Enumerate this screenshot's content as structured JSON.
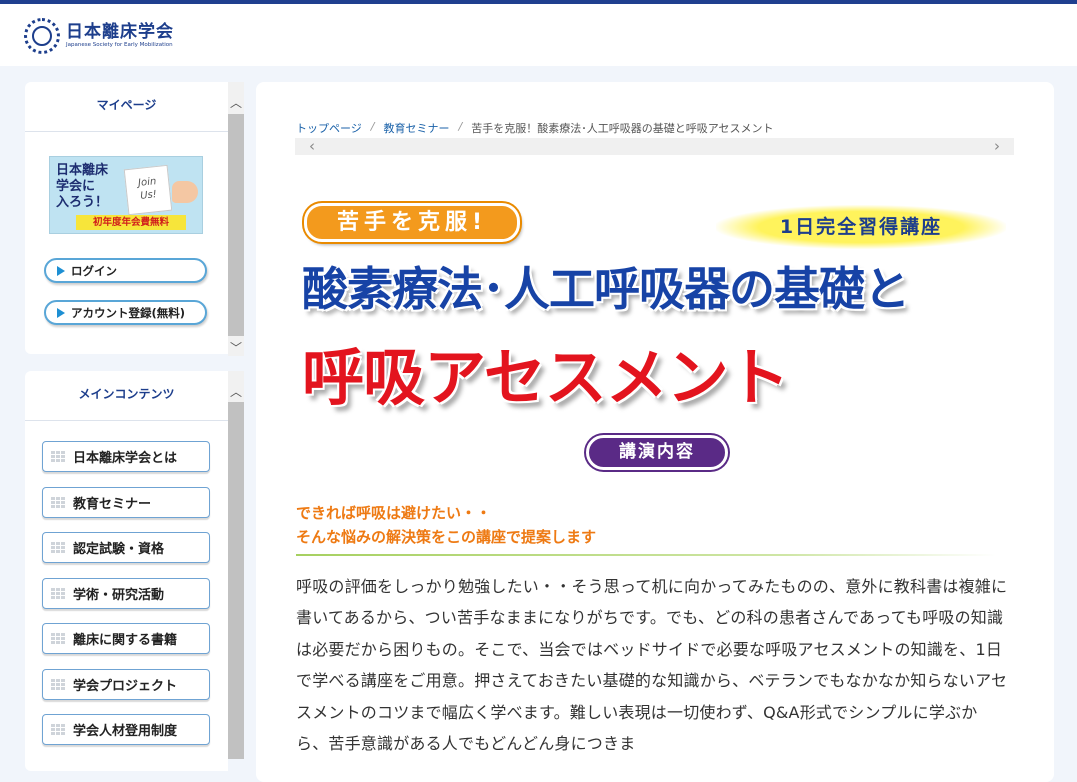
{
  "header": {
    "logo_name": "日本離床学会",
    "logo_sub": "Japanese Society for Early Mobilization"
  },
  "sidebar": {
    "mypage": {
      "title": "マイページ",
      "banner": {
        "headline": "日本離床\n学会に\n入ろう！",
        "note": "Join\nUs!",
        "fee": "初年度年会費無料"
      },
      "buttons": [
        {
          "label": "ログイン"
        },
        {
          "label": "アカウント登録(無料)"
        }
      ]
    },
    "main": {
      "title": "メインコンテンツ",
      "items": [
        {
          "label": "日本離床学会とは"
        },
        {
          "label": "教育セミナー"
        },
        {
          "label": "認定試験・資格"
        },
        {
          "label": "学術・研究活動"
        },
        {
          "label": "離床に関する書籍"
        },
        {
          "label": "学会プロジェクト"
        },
        {
          "label": "学会人材登用制度"
        }
      ]
    }
  },
  "breadcrumb": {
    "items": [
      "トップページ",
      "教育セミナー"
    ],
    "current": "苦手を克服！酸素療法･人工呼吸器の基礎と呼吸アセスメント"
  },
  "hero": {
    "tag": "苦手を克服!",
    "badge": "1日完全習得講座",
    "line1": "酸素療法･人工呼吸器の基礎と",
    "line2": "呼吸アセスメント"
  },
  "section": {
    "pill": "講演内容",
    "lead1": "できれば呼吸は避けたい・・",
    "lead2": "そんな悩みの解決策をこの講座で提案します",
    "body": "呼吸の評価をしっかり勉強したい・・そう思って机に向かってみたものの、意外に教科書は複雑に書いてあるから、つい苦手なままになりがちです。でも、どの科の患者さんであっても呼吸の知識は必要だから困りもの。そこで、当会ではベッドサイドで必要な呼吸アセスメントの知識を、1日で学べる講座をご用意。押さえておきたい基礎的な知識から、ベテランでもなかなか知らないアセスメントのコツまで幅広く学べます。難しい表現は一切使わず、Q&A形式でシンプルに学ぶから、苦手意識がある人でもどんどん身につきま"
  },
  "colors": {
    "brand": "#1d3e8c",
    "accent_orange": "#ee7a13",
    "title_blue": "#1743a6",
    "title_red": "#e3141e",
    "pill_purple": "#5a2a86"
  }
}
